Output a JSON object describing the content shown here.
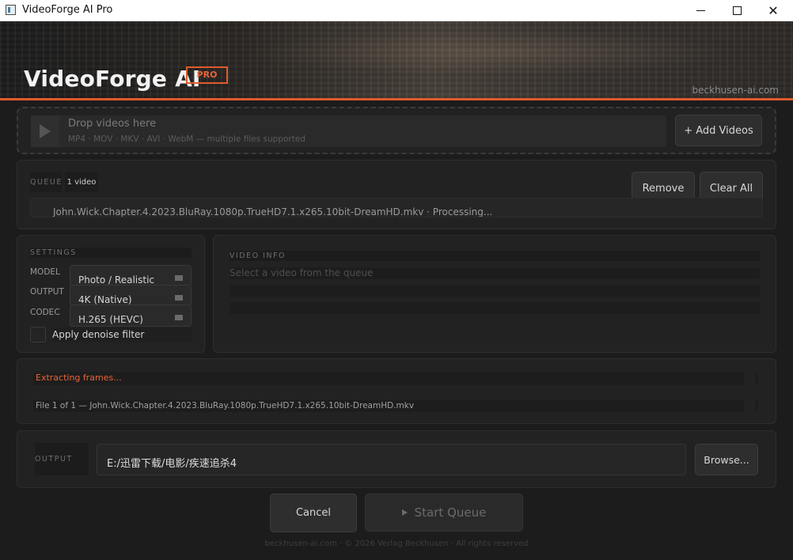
{
  "window": {
    "title": "VideoForge AI Pro"
  },
  "header": {
    "brand": "VideoForge AI",
    "badge": "PRO",
    "site": "beckhusen-ai.com"
  },
  "dropzone": {
    "title": "Drop videos here",
    "formats": "MP4 · MOV · MKV · AVI · WebM — multiple files supported",
    "add_button": "+ Add Videos"
  },
  "queue": {
    "label": "QUEUE",
    "count": "1 video",
    "remove_button": "Remove",
    "clear_button": "Clear All",
    "items": [
      {
        "text": "John.Wick.Chapter.4.2023.BluRay.1080p.TrueHD7.1.x265.10bit-DreamHD.mkv  ·  Processing..."
      }
    ]
  },
  "settings": {
    "header": "SETTINGS",
    "model_label": "MODEL",
    "model_value": "Photo / Realistic",
    "output_label": "OUTPUT",
    "output_value": "4K (Native)",
    "codec_label": "CODEC",
    "codec_value": "H.265 (HEVC)",
    "denoise_label": "Apply denoise filter"
  },
  "video_info": {
    "header": "VIDEO INFO",
    "placeholder": "Select a video from the queue"
  },
  "progress": {
    "status": "Extracting frames...",
    "file": "File 1 of 1  —  John.Wick.Chapter.4.2023.BluRay.1080p.TrueHD7.1.x265.10bit-DreamHD.mkv"
  },
  "output": {
    "label": "OUTPUT",
    "path": "E:/迅雷下载/电影/疾速追杀4",
    "browse_button": "Browse..."
  },
  "actions": {
    "cancel_button": "Cancel",
    "start_button": "Start Queue"
  },
  "footer": {
    "text": "beckhusen-ai.com  ·  © 2026 Verlag Beckhusen  ·  All rights reserved"
  },
  "colors": {
    "accent": "#e05a2b",
    "background": "#1c1c1c",
    "panel": "#222222"
  }
}
